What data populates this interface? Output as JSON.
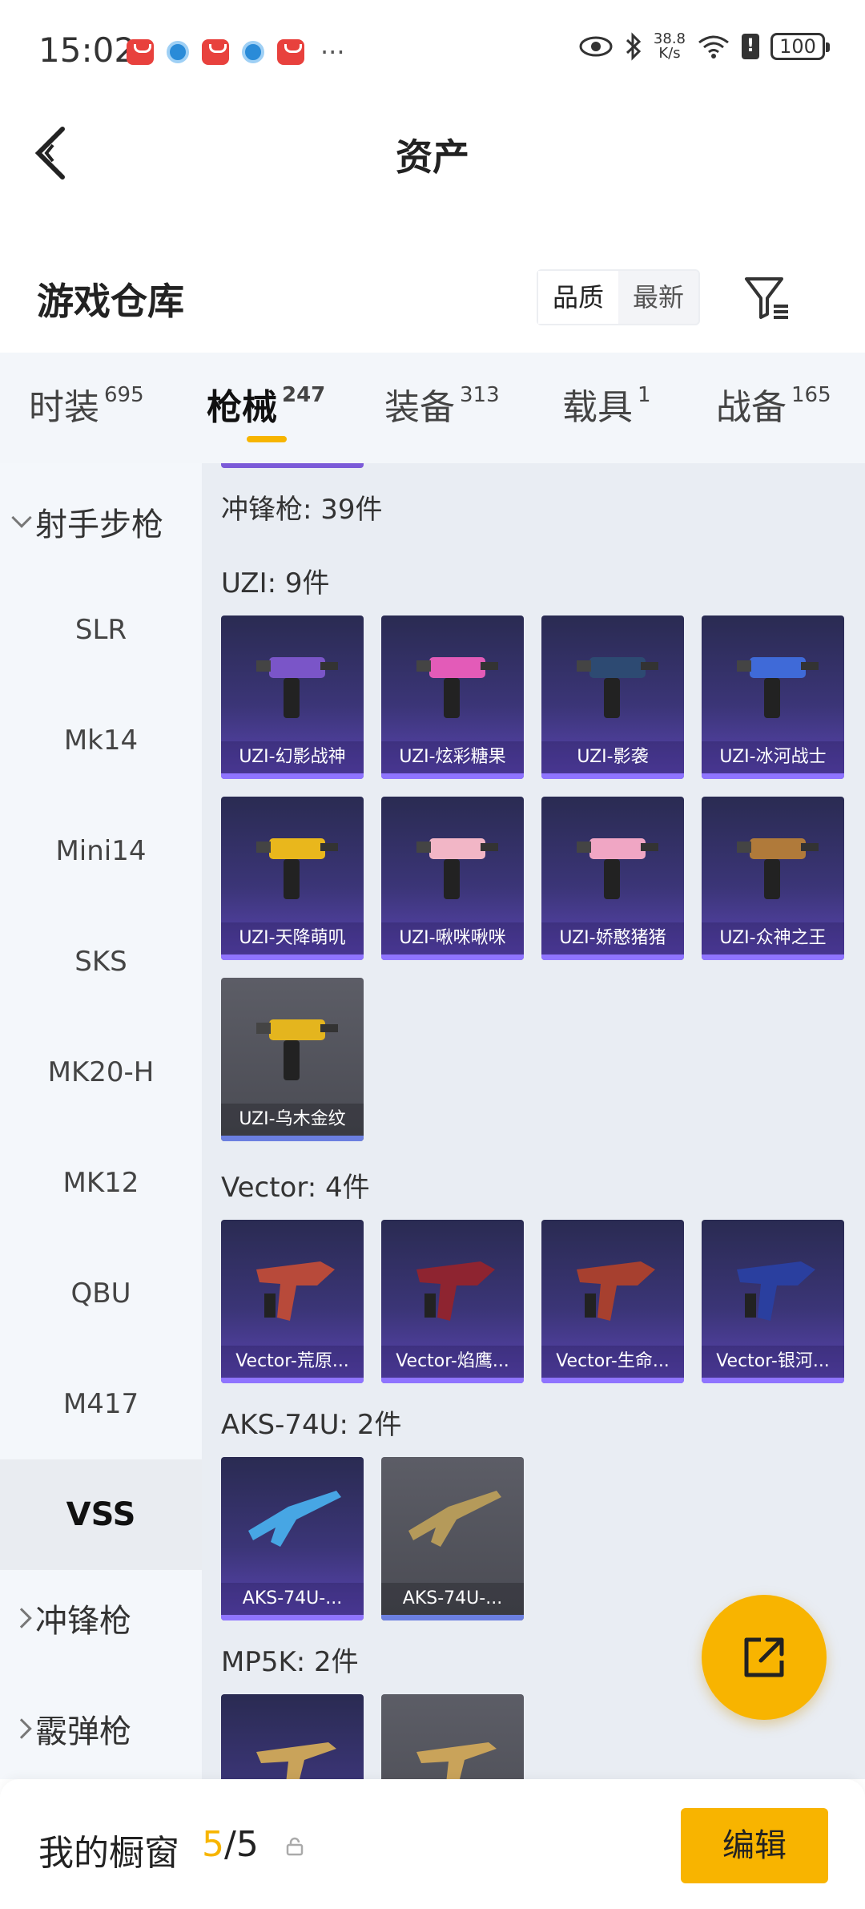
{
  "status_bar": {
    "time": "15:02",
    "more": "···",
    "net_speed_value": "38.8",
    "net_speed_unit": "K/s",
    "battery": "100",
    "alert": "!"
  },
  "nav": {
    "title": "资产",
    "back_icon": "chevron-left-icon"
  },
  "warehouse": {
    "title": "游戏仓库",
    "sort_options": [
      "品质",
      "最新"
    ],
    "active_sort": "品质",
    "filter_icon": "filter-icon"
  },
  "tabs": [
    {
      "label": "时装",
      "count": "695"
    },
    {
      "label": "枪械",
      "count": "247"
    },
    {
      "label": "装备",
      "count": "313"
    },
    {
      "label": "载具",
      "count": "1"
    },
    {
      "label": "战备",
      "count": "165"
    }
  ],
  "active_tab": "枪械",
  "sidebar": {
    "group_expanded": "射手步枪",
    "items": [
      "SLR",
      "Mk14",
      "Mini14",
      "SKS",
      "MK20-H",
      "MK12",
      "QBU",
      "M417",
      "VSS"
    ],
    "active_item": "VSS",
    "group_collapsed_1": "冲锋枪",
    "group_collapsed_2": "霰弹枪"
  },
  "content": {
    "category_label": "冲锋枪: 39件",
    "sections": [
      {
        "label": "UZI: 9件",
        "items": [
          {
            "name": "UZI-幻影战神",
            "style": "purple"
          },
          {
            "name": "UZI-炫彩糖果",
            "style": "purple"
          },
          {
            "name": "UZI-影袭",
            "style": "purple"
          },
          {
            "name": "UZI-冰河战士",
            "style": "purple"
          },
          {
            "name": "UZI-天降萌叽",
            "style": "purple"
          },
          {
            "name": "UZI-啾咪啾咪",
            "style": "purple"
          },
          {
            "name": "UZI-娇憨猪猪",
            "style": "purple"
          },
          {
            "name": "UZI-众神之王",
            "style": "purple"
          },
          {
            "name": "UZI-乌木金纹",
            "style": "gray"
          }
        ]
      },
      {
        "label": "Vector: 4件",
        "items": [
          {
            "name": "Vector-荒原...",
            "style": "purple"
          },
          {
            "name": "Vector-焰鹰...",
            "style": "purple"
          },
          {
            "name": "Vector-生命...",
            "style": "purple"
          },
          {
            "name": "Vector-银河...",
            "style": "purple"
          }
        ]
      },
      {
        "label": "AKS-74U: 2件",
        "items": [
          {
            "name": "AKS-74U-...",
            "style": "purple"
          },
          {
            "name": "AKS-74U-...",
            "style": "gray"
          }
        ]
      },
      {
        "label": "MP5K: 2件",
        "items": [
          {
            "name": "",
            "style": "purple"
          },
          {
            "name": "",
            "style": "gray"
          }
        ]
      }
    ]
  },
  "fab": {
    "icon": "share-external-icon"
  },
  "showcase": {
    "title": "我的橱窗",
    "count_current": "5",
    "count_sep": "/5",
    "lock_icon": "lock-icon",
    "edit_label": "编辑"
  },
  "colors": {
    "accent": "#f8b400",
    "card_purple": "#3b3577",
    "card_gray": "#4a4b53",
    "sidebar_bg": "#f4f7fb"
  }
}
